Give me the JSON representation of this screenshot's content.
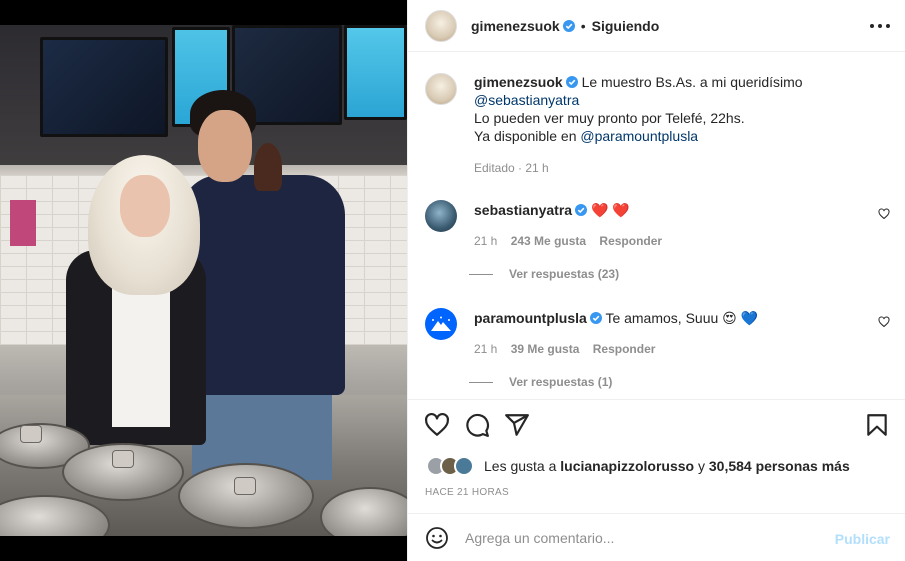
{
  "header": {
    "username": "gimenezsuok",
    "separator": "•",
    "follow_label": "Siguiendo"
  },
  "caption": {
    "username": "gimenezsuok",
    "line1": "Le muestro Bs.As. a mi queridísimo",
    "mention1": "@sebastianyatra",
    "line2": "Lo pueden ver muy pronto por Telefé, 22hs.",
    "line3_prefix": "Ya disponible en",
    "mention2": "@paramountplusla",
    "meta": "Editado · 21 h"
  },
  "comments": [
    {
      "username": "sebastianyatra",
      "text": "❤️ ❤️",
      "time": "21 h",
      "likes": "243 Me gusta",
      "reply_label": "Responder",
      "view_replies": "Ver respuestas (23)"
    },
    {
      "username": "paramountplusla",
      "text": "Te amamos, Suuu 😍 💙",
      "time": "21 h",
      "likes": "39 Me gusta",
      "reply_label": "Responder",
      "view_replies": "Ver respuestas (1)"
    }
  ],
  "likes": {
    "prefix": "Les gusta a",
    "user": "lucianapizzolorusso",
    "middle": "y",
    "others": "30,584 personas más"
  },
  "timestamp": "HACE 21 HORAS",
  "add_comment": {
    "placeholder": "Agrega un comentario...",
    "publish_label": "Publicar"
  },
  "colors": {
    "verified": "#3897f0",
    "link": "#00376b",
    "muted": "#8e8e8e",
    "publish_disabled": "#b2dffc"
  },
  "icons": [
    "more-options-icon",
    "heart-icon",
    "comment-icon",
    "share-icon",
    "bookmark-icon",
    "emoji-icon",
    "verified-icon"
  ]
}
